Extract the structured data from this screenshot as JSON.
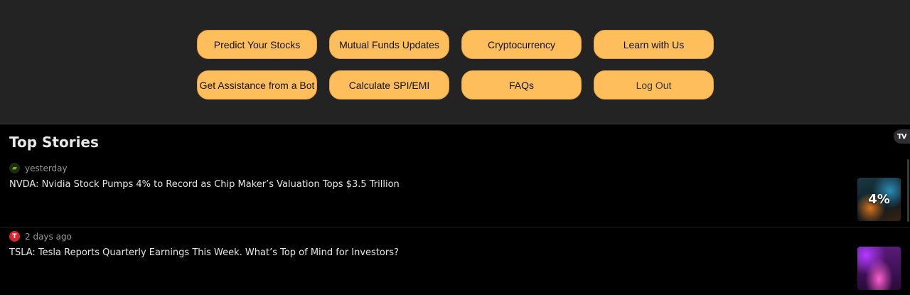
{
  "nav": {
    "buttons": [
      "Predict Your Stocks",
      "Mutual Funds Updates",
      "Cryptocurrency",
      "Learn with Us",
      "Get Assistance from a Bot",
      "Calculate SPI/EMI",
      "FAQs",
      "Log Out"
    ]
  },
  "widget": {
    "title": "Top Stories",
    "brand": "TV",
    "stories": [
      {
        "source_icon": "nvidia-logo-icon",
        "time": "yesterday",
        "headline": "NVDA: Nvidia Stock Pumps 4% to Record as Chip Maker’s Valuation Tops $3.5 Trillion",
        "thumb_label": "4%"
      },
      {
        "source_icon": "tesla-logo-icon",
        "time": "2 days ago",
        "headline": "TSLA: Tesla Reports Quarterly Earnings This Week. What’s Top of Mind for Investors?",
        "thumb_label": ""
      }
    ]
  },
  "colors": {
    "button_bg": "#ffbe5c",
    "panel_bg": "#232323",
    "widget_bg": "#000000"
  }
}
